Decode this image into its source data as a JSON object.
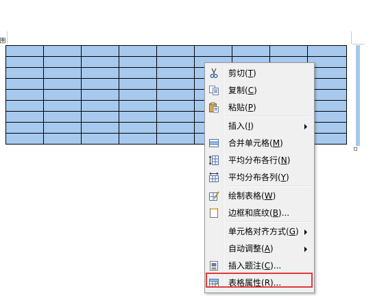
{
  "context_menu": {
    "items": [
      {
        "label": "剪切",
        "accel": "T",
        "icon": "scissors-icon"
      },
      {
        "label": "复制",
        "accel": "C",
        "icon": "copy-icon"
      },
      {
        "label": "粘贴",
        "accel": "P",
        "icon": "paste-icon"
      },
      {
        "label": "插入",
        "accel": "I",
        "submenu": true
      },
      {
        "label": "合并单元格",
        "accel": "M",
        "icon": "merge-cells-icon"
      },
      {
        "label": "平均分布各行",
        "accel": "N",
        "icon": "distribute-rows-icon"
      },
      {
        "label": "平均分布各列",
        "accel": "Y",
        "icon": "distribute-columns-icon"
      },
      {
        "label": "绘制表格",
        "accel": "W",
        "icon": "draw-table-icon"
      },
      {
        "label": "边框和底纹",
        "accel": "B",
        "suffix": "...",
        "icon": "borders-shading-icon"
      },
      {
        "label": "单元格对齐方式",
        "accel": "G",
        "submenu": true
      },
      {
        "label": "自动调整",
        "accel": "A",
        "submenu": true
      },
      {
        "label": "插入题注",
        "accel": "C",
        "suffix": "...",
        "icon": "insert-caption-icon"
      },
      {
        "label": "表格属性",
        "accel": "R",
        "suffix": "...",
        "icon": "table-properties-icon",
        "highlighted": true
      }
    ]
  },
  "table": {
    "rows": 9,
    "columns": 9,
    "selected": true
  },
  "colors": {
    "selection": "#a8c9ee",
    "highlight": "#e0383b"
  }
}
